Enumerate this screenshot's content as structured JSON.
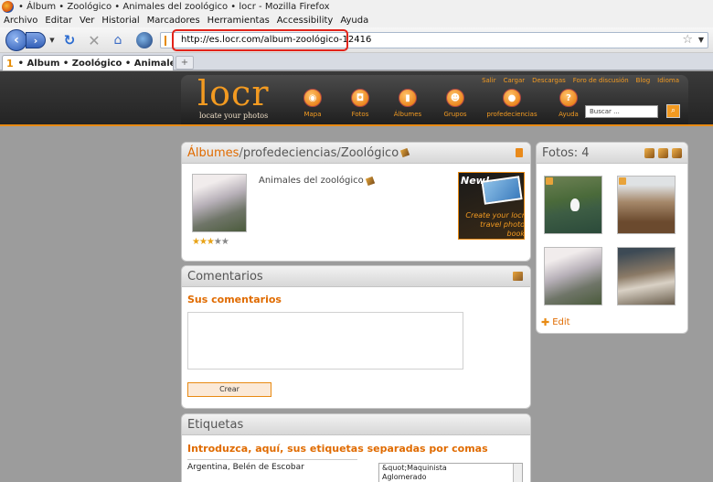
{
  "browser": {
    "window_title": "• Álbum • Zoológico • Animales del zoológico • locr - Mozilla Firefox",
    "menu": [
      "Archivo",
      "Editar",
      "Ver",
      "Historial",
      "Marcadores",
      "Herramientas",
      "Accessibility",
      "Ayuda"
    ],
    "url": "http://es.locr.com/album-zoológico-12416",
    "tab_title": "• Álbum • Zoológico • Animales del zo...",
    "new_tab_label": "+"
  },
  "site": {
    "logo": "locr",
    "tagline": "locate your photos",
    "top_links": [
      "Salir",
      "Cargar",
      "Descargas",
      "Foro de discusión",
      "Blog",
      "Idioma"
    ],
    "main_nav": [
      "Mapa",
      "Fotos",
      "Álbumes",
      "Grupos",
      "profedeciencias",
      "Ayuda"
    ],
    "search_placeholder": "Buscar ...",
    "accent": "#f29a21"
  },
  "album": {
    "crumb_albums": "Álbumes",
    "crumb_user": "profedeciencias",
    "crumb_album": "Zoológico",
    "separator": "/",
    "name": "Animales del zoológico",
    "rating": 3,
    "rating_max": 5,
    "promo_new": "New!",
    "promo_text": "Create your locr travel photo book"
  },
  "comments": {
    "title": "Comentarios",
    "subtitle": "Sus comentarios",
    "button": "Crear"
  },
  "tags": {
    "title": "Etiquetas",
    "subtitle": "Introduzca, aquí, sus etiquetas separadas por comas",
    "value": "Argentina, Belén de Escobar",
    "suggestions": [
      "&quot;Maquinista",
      "Aglomerado"
    ]
  },
  "photos": {
    "title": "Fotos: 4",
    "edit": "Edit"
  }
}
